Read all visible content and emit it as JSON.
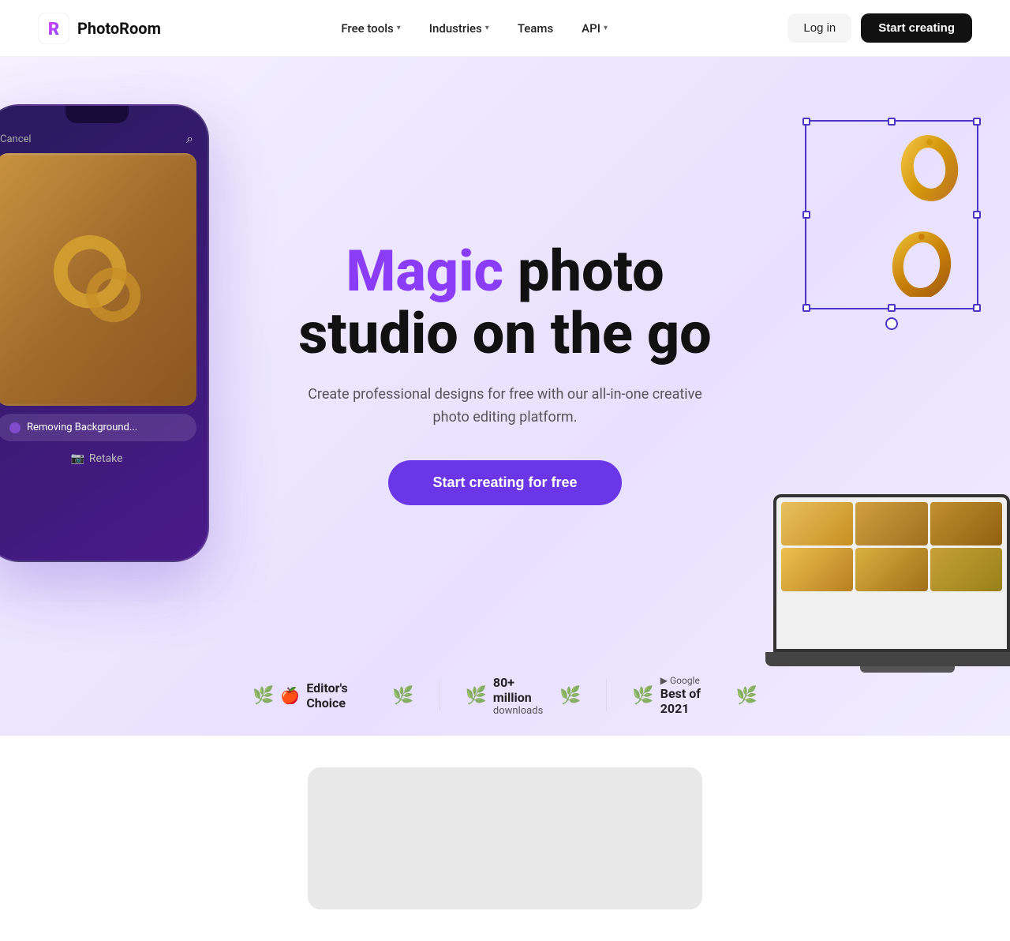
{
  "brand": {
    "name": "PhotoRoom",
    "logo_initial": "R"
  },
  "nav": {
    "links": [
      {
        "id": "free-tools",
        "label": "Free tools",
        "hasDropdown": true
      },
      {
        "id": "industries",
        "label": "Industries",
        "hasDropdown": true
      },
      {
        "id": "teams",
        "label": "Teams",
        "hasDropdown": false
      },
      {
        "id": "api",
        "label": "API",
        "hasDropdown": true
      }
    ],
    "login_label": "Log in",
    "start_label": "Start creating"
  },
  "hero": {
    "title_magic": "Magic",
    "title_rest": " photo\nstudio on the go",
    "subtitle": "Create professional designs for free with our all-in-one creative photo editing platform.",
    "cta_label": "Start creating for free"
  },
  "phone": {
    "cancel_label": "Cancel",
    "retake_label": "Retake",
    "removing_text": "Removing Background..."
  },
  "badges": [
    {
      "id": "editors-choice",
      "icon": "apple",
      "main_text": "Editor's Choice",
      "sub_text": ""
    },
    {
      "id": "downloads",
      "icon": "",
      "main_text": "80+ million",
      "sub_text": "downloads"
    },
    {
      "id": "google-best",
      "icon": "google-play",
      "main_text": "Best of 2021",
      "sub_text": ""
    }
  ]
}
